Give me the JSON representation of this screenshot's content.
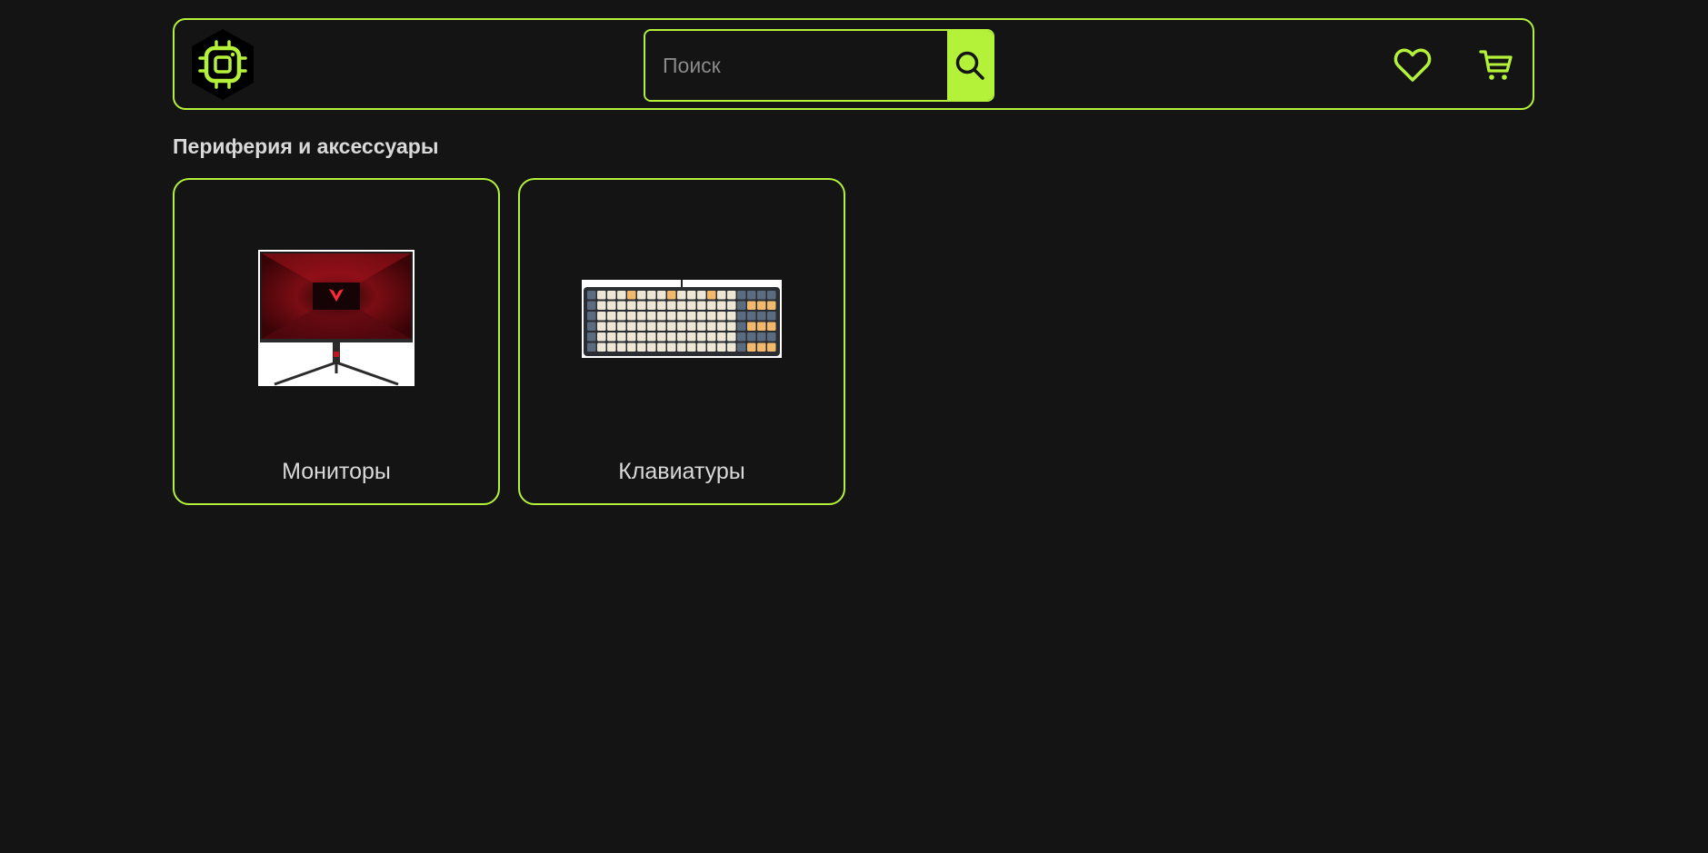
{
  "colors": {
    "background": "#141414",
    "accent": "#b4f23a",
    "text": "#d9d9d9"
  },
  "header": {
    "logo_icon": "chip-logo-icon",
    "search": {
      "placeholder": "Поиск",
      "value": "",
      "button_icon": "search-icon"
    },
    "favorites_icon": "heart-icon",
    "cart_icon": "cart-icon"
  },
  "section": {
    "title": "Периферия и аксессуары"
  },
  "categories": [
    {
      "label": "Мониторы",
      "image": "monitor-image"
    },
    {
      "label": "Клавиатуры",
      "image": "keyboard-image"
    }
  ]
}
